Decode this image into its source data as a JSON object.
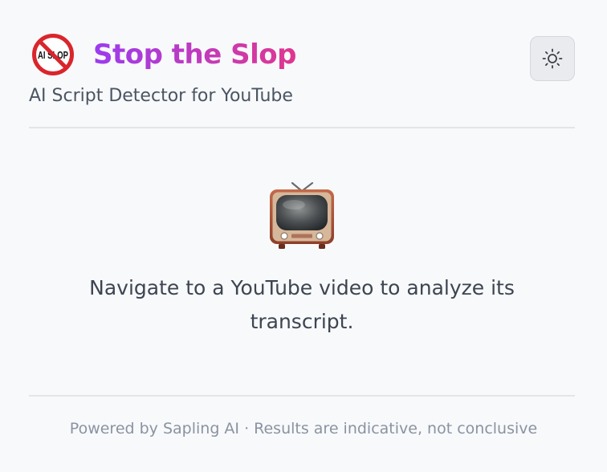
{
  "header": {
    "logo": {
      "icon": "no-ai-slop-icon",
      "text": "AI SLOP"
    },
    "title": "Stop the Slop",
    "subtitle": "AI Script Detector for YouTube",
    "theme_toggle": {
      "icon": "sun-icon"
    }
  },
  "empty_state": {
    "icon": "television-icon",
    "message": "Navigate to a YouTube video to analyze its transcript."
  },
  "footer": {
    "text": "Powered by Sapling AI · Results are indicative, not conclusive"
  },
  "colors": {
    "background": "#f8f9fb",
    "title_gradient_start": "#9b3bf0",
    "title_gradient_end": "#e0368f",
    "prohibition_red": "#d9262c",
    "footer_text": "#8a93a1"
  }
}
